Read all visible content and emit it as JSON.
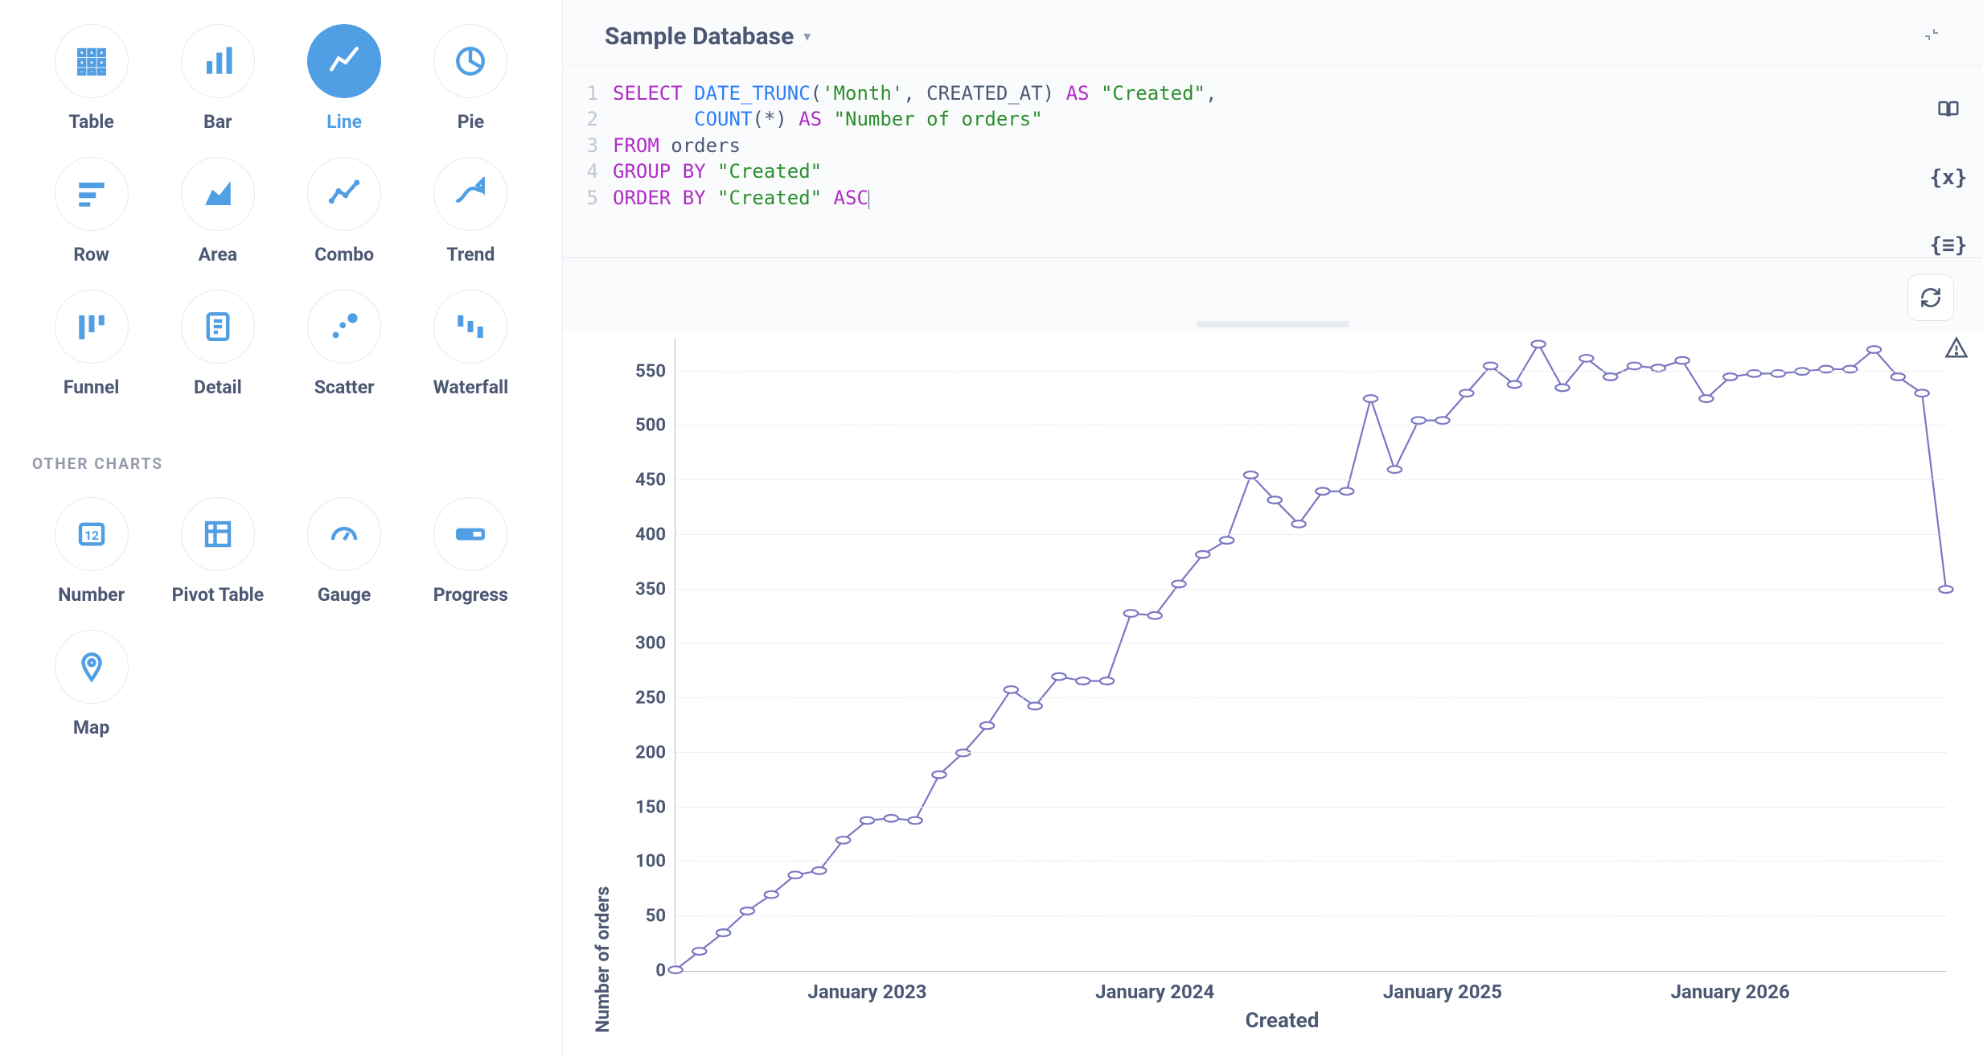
{
  "sidebar": {
    "viz_types": [
      {
        "id": "table",
        "label": "Table",
        "icon": "table",
        "selected": false
      },
      {
        "id": "bar",
        "label": "Bar",
        "icon": "bar",
        "selected": false
      },
      {
        "id": "line",
        "label": "Line",
        "icon": "line",
        "selected": true
      },
      {
        "id": "pie",
        "label": "Pie",
        "icon": "pie",
        "selected": false
      },
      {
        "id": "row",
        "label": "Row",
        "icon": "row",
        "selected": false
      },
      {
        "id": "area",
        "label": "Area",
        "icon": "area",
        "selected": false
      },
      {
        "id": "combo",
        "label": "Combo",
        "icon": "combo",
        "selected": false
      },
      {
        "id": "trend",
        "label": "Trend",
        "icon": "trend",
        "selected": false
      },
      {
        "id": "funnel",
        "label": "Funnel",
        "icon": "funnel",
        "selected": false
      },
      {
        "id": "detail",
        "label": "Detail",
        "icon": "detail",
        "selected": false
      },
      {
        "id": "scatter",
        "label": "Scatter",
        "icon": "scatter",
        "selected": false
      },
      {
        "id": "waterfall",
        "label": "Waterfall",
        "icon": "waterfall",
        "selected": false
      }
    ],
    "other_title": "OTHER CHARTS",
    "other_types": [
      {
        "id": "number",
        "label": "Number",
        "icon": "number"
      },
      {
        "id": "pivot",
        "label": "Pivot Table",
        "icon": "pivot"
      },
      {
        "id": "gauge",
        "label": "Gauge",
        "icon": "gauge"
      },
      {
        "id": "progress",
        "label": "Progress",
        "icon": "progress"
      },
      {
        "id": "map",
        "label": "Map",
        "icon": "map"
      }
    ]
  },
  "header": {
    "database_label": "Sample Database"
  },
  "sql": {
    "lines": [
      1,
      2,
      3,
      4,
      5
    ],
    "tokens": [
      [
        [
          "kw",
          "SELECT"
        ],
        [
          "",
          " "
        ],
        [
          "fn",
          "DATE_TRUNC"
        ],
        [
          "",
          "("
        ],
        [
          "str",
          "'Month'"
        ],
        [
          "",
          ", "
        ],
        [
          "ident",
          "CREATED_AT"
        ],
        [
          "",
          ") "
        ],
        [
          "kw",
          "AS"
        ],
        [
          "",
          " "
        ],
        [
          "str",
          "\"Created\""
        ],
        [
          "",
          ","
        ]
      ],
      [
        [
          "",
          "       "
        ],
        [
          "fn",
          "COUNT"
        ],
        [
          "",
          "(*) "
        ],
        [
          "kw",
          "AS"
        ],
        [
          "",
          " "
        ],
        [
          "str",
          "\"Number of orders\""
        ]
      ],
      [
        [
          "kw",
          "FROM"
        ],
        [
          "",
          " "
        ],
        [
          "ident",
          "orders"
        ]
      ],
      [
        [
          "kw",
          "GROUP BY"
        ],
        [
          "",
          " "
        ],
        [
          "str",
          "\"Created\""
        ]
      ],
      [
        [
          "kw",
          "ORDER BY"
        ],
        [
          "",
          " "
        ],
        [
          "str",
          "\"Created\""
        ],
        [
          "",
          " "
        ],
        [
          "kw",
          "ASC"
        ]
      ]
    ]
  },
  "chart_data": {
    "type": "line",
    "xlabel": "Created",
    "ylabel": "Number of orders",
    "y_ticks": [
      0,
      50,
      100,
      150,
      200,
      250,
      300,
      350,
      400,
      450,
      500,
      550
    ],
    "ylim": [
      0,
      580
    ],
    "x_ticks": [
      "January 2023",
      "January 2024",
      "January 2025",
      "January 2026"
    ],
    "x_tick_indices": [
      8,
      20,
      32,
      44
    ],
    "x": [
      0,
      1,
      2,
      3,
      4,
      5,
      6,
      7,
      8,
      9,
      10,
      11,
      12,
      13,
      14,
      15,
      16,
      17,
      18,
      19,
      20,
      21,
      22,
      23,
      24,
      25,
      26,
      27,
      28,
      29,
      30,
      31,
      32,
      33,
      34,
      35,
      36,
      37,
      38,
      39,
      40,
      41,
      42,
      43,
      44,
      45,
      46,
      47
    ],
    "values": [
      1,
      18,
      35,
      55,
      70,
      88,
      92,
      120,
      138,
      140,
      138,
      180,
      200,
      225,
      258,
      243,
      270,
      266,
      266,
      328,
      326,
      355,
      382,
      395,
      455,
      432,
      410,
      440,
      440,
      525,
      460,
      505,
      505,
      530,
      555,
      538,
      575,
      535,
      562,
      545,
      555,
      553,
      560,
      525,
      545,
      548,
      548,
      550,
      552,
      552,
      570,
      545,
      530,
      350
    ],
    "series": [
      {
        "name": "Number of orders",
        "values": [
          1,
          18,
          35,
          55,
          70,
          88,
          92,
          120,
          138,
          140,
          138,
          180,
          200,
          225,
          258,
          243,
          270,
          266,
          266,
          328,
          326,
          355,
          382,
          395,
          455,
          432,
          410,
          440,
          440,
          525,
          460,
          505,
          505,
          530,
          555,
          538,
          575,
          535,
          562,
          545,
          555,
          553,
          560,
          525,
          545,
          548,
          548,
          550,
          552,
          552,
          570,
          545,
          530,
          350
        ]
      }
    ]
  },
  "icons": {
    "book": "book-icon",
    "variable": "variable-icon",
    "snippet": "snippet-icon",
    "refresh": "refresh-icon",
    "warn": "warning-icon",
    "collapse": "collapse-icon"
  }
}
